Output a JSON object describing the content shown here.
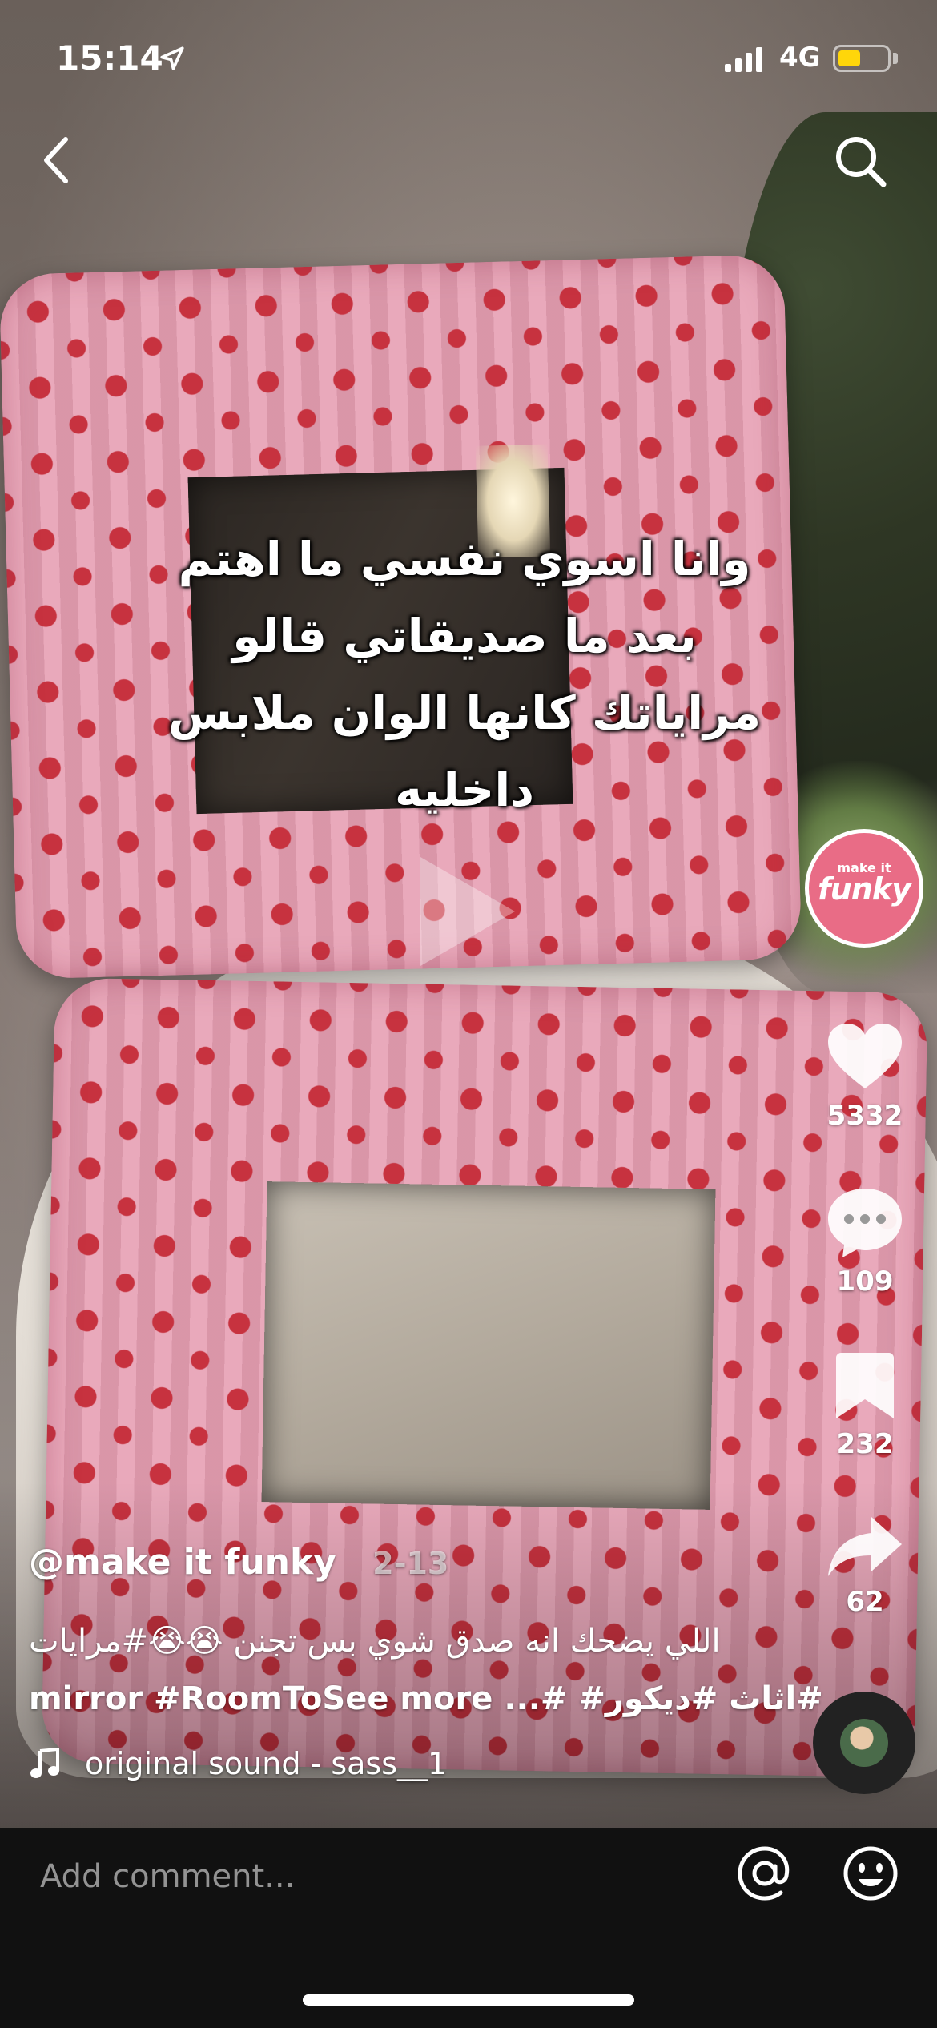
{
  "status_bar": {
    "time": "15:14",
    "network": "4G",
    "battery_level": 0.45
  },
  "video": {
    "overlay_text": [
      "وانا اسوي نفسي ما اهتم",
      "بعد ما صديقاتي قالو",
      "مراياتك كانها الوان ملابس",
      "داخليه"
    ]
  },
  "rail": {
    "avatar_small_text": "make it",
    "avatar_big_text": "funky",
    "likes": "5332",
    "comments": "109",
    "saves": "232",
    "shares": "62"
  },
  "caption": {
    "username": "@make it funky",
    "date": "2-13",
    "line1": "اللي يضحك انه صدق شوي بس تجنن 😭😭#مرايات",
    "line2": "mirror #RoomToSee more ...# #اثاث #ديكور#",
    "sound": "original sound - sass__1"
  },
  "comment_bar": {
    "placeholder": "Add comment..."
  },
  "colors": {
    "battery": "#ffd60a",
    "avatar_bg": "#e96c86",
    "frame_pink": "#e79fb3",
    "heart_red": "#c7323f"
  }
}
